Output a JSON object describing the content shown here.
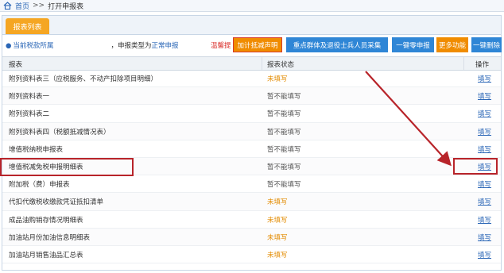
{
  "breadcrumb": {
    "home": "首页",
    "separator": ">>",
    "current": "打开申报表"
  },
  "tabs": [
    {
      "label": "报表列表",
      "active": true
    }
  ],
  "toolbar": {
    "info_prefix": "当前税款所属",
    "info_mid": "，申报类型为",
    "info_value": "正常申报",
    "warning": "温馨提",
    "buttons": [
      {
        "label": "加计抵减声明",
        "style": "orange"
      },
      {
        "label": "重点群体及退役士兵人员采集",
        "style": "blue"
      },
      {
        "label": "一键零申报",
        "style": "blue"
      },
      {
        "label": "更多功能",
        "style": "orange"
      },
      {
        "label": "一键删除",
        "style": "blue"
      }
    ]
  },
  "table": {
    "headers": [
      "报表",
      "报表状态",
      "操作"
    ],
    "rows": [
      {
        "name": "附列资料表三（应税服务、不动产扣除项目明细）",
        "status": "未填写",
        "status_color": "orange",
        "op": "填写"
      },
      {
        "name": "附列资料表一",
        "status": "暂不能填写",
        "status_color": "gray",
        "op": "填写"
      },
      {
        "name": "附列资料表二",
        "status": "暂不能填写",
        "status_color": "gray",
        "op": "填写"
      },
      {
        "name": "附列资料表四（税额抵减情况表）",
        "status": "暂不能填写",
        "status_color": "gray",
        "op": "填写"
      },
      {
        "name": "增值税纳税申报表",
        "status": "暂不能填写",
        "status_color": "gray",
        "op": "填写"
      },
      {
        "name": "增值税减免税申报明细表",
        "status": "暂不能填写",
        "status_color": "gray",
        "op": "填写"
      },
      {
        "name": "附加税（费）申报表",
        "status": "暂不能填写",
        "status_color": "gray",
        "op": "填写"
      },
      {
        "name": "代扣代缴税收缴款凭证抵扣清单",
        "status": "未填写",
        "status_color": "orange",
        "op": "填写"
      },
      {
        "name": "成品油购销存情况明细表",
        "status": "未填写",
        "status_color": "orange",
        "op": "填写"
      },
      {
        "name": "加油站月份加油信息明细表",
        "status": "未填写",
        "status_color": "orange",
        "op": "填写"
      },
      {
        "name": "加油站月销售油品汇总表",
        "status": "未填写",
        "status_color": "orange",
        "op": "填写"
      }
    ]
  },
  "colors": {
    "accent_orange": "#f5a623",
    "button_blue": "#2f86d6",
    "highlight_red": "#b8242a",
    "link_blue": "#2a66b6"
  }
}
